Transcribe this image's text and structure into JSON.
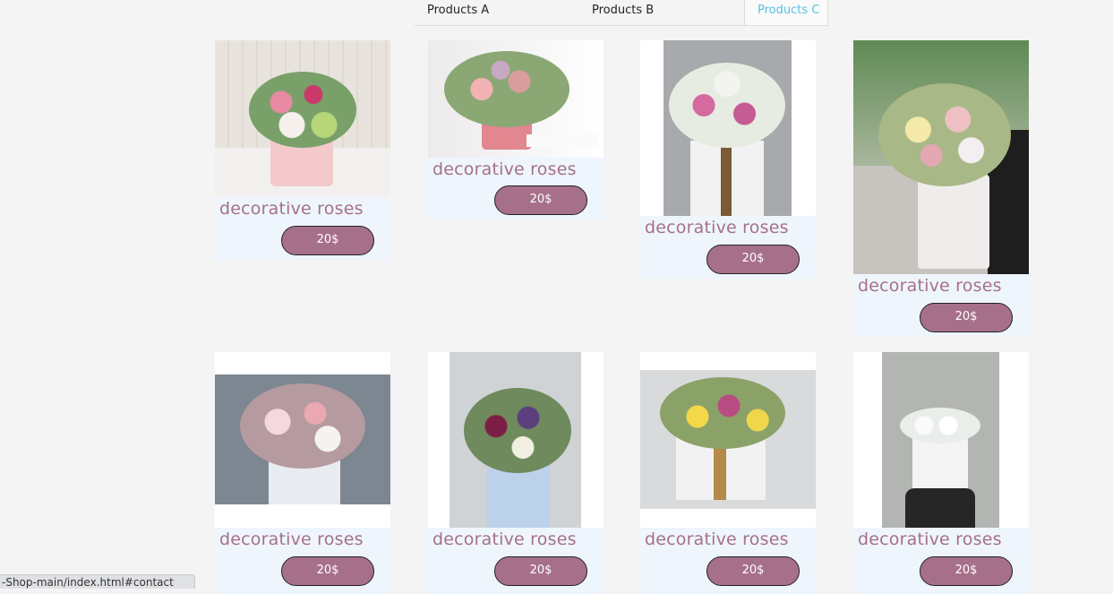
{
  "tabs": [
    {
      "label": "Products A"
    },
    {
      "label": "Products B"
    },
    {
      "label": "Products C"
    }
  ],
  "products": [
    {
      "title": "decorative roses",
      "price": "20$"
    },
    {
      "title": "decorative roses",
      "price": "20$"
    },
    {
      "title": "decorative roses",
      "price": "20$"
    },
    {
      "title": "decorative roses",
      "price": "20$"
    },
    {
      "title": "decorative roses",
      "price": "20$"
    },
    {
      "title": "decorative roses",
      "price": "20$"
    },
    {
      "title": "decorative roses",
      "price": "20$"
    },
    {
      "title": "decorative roses",
      "price": "20$"
    }
  ],
  "status_bar": {
    "url": "-Shop-main/index.html#contact"
  },
  "colors": {
    "accent": "#a6708a",
    "active_tab": "#5bc0de",
    "card_bg": "#eef5fd",
    "page_bg": "#f4f4f4"
  }
}
